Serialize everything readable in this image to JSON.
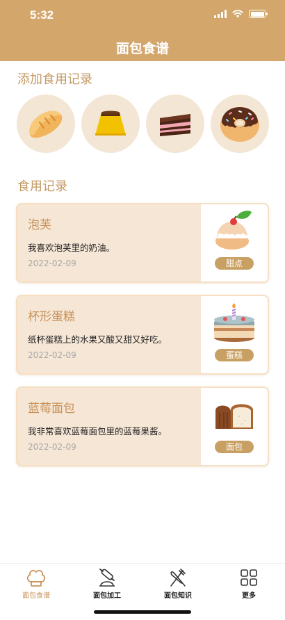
{
  "status": {
    "time": "5:32"
  },
  "header": {
    "title": "面包食谱"
  },
  "add_section": {
    "title": "添加食用记录",
    "icons": [
      "bread-icon",
      "pudding-icon",
      "cake-slice-icon",
      "donut-icon"
    ]
  },
  "records": {
    "title": "食用记录",
    "items": [
      {
        "title": "泡芙",
        "desc": "我喜欢泡芙里的奶油。",
        "date": "2022-02-09",
        "tag": "甜点",
        "icon": "cream-puff-icon"
      },
      {
        "title": "杯形蛋糕",
        "desc": "纸杯蛋糕上的水果又酸又甜又好吃。",
        "date": "2022-02-09",
        "tag": "蛋糕",
        "icon": "birthday-cake-icon"
      },
      {
        "title": "蓝莓面包",
        "desc": "我非常喜欢蓝莓面包里的蓝莓果酱。",
        "date": "2022-02-09",
        "tag": "面包",
        "icon": "toast-bread-icon"
      }
    ]
  },
  "tabbar": {
    "tabs": [
      {
        "label": "面包食谱",
        "icon": "chef-hat-icon",
        "active": true
      },
      {
        "label": "面包加工",
        "icon": "rolling-pin-icon",
        "active": false
      },
      {
        "label": "面包知识",
        "icon": "fork-knife-icon",
        "active": false
      },
      {
        "label": "更多",
        "icon": "grid-icon",
        "active": false
      }
    ]
  },
  "colors": {
    "brand": "#d3a66b",
    "accent": "#c9925a",
    "card_bg": "#f5e6d5",
    "tag_bg": "#c9a063"
  }
}
